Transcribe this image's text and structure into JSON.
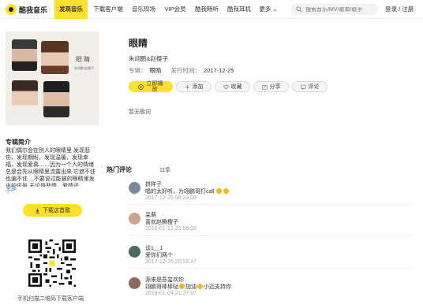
{
  "brand": {
    "name": "酷我音乐",
    "accent": "#ffe12d"
  },
  "nav": {
    "items": [
      {
        "label": "发现音乐",
        "active": true
      },
      {
        "label": "下载客户端"
      },
      {
        "label": "音乐现场"
      },
      {
        "label": "VIP会员"
      },
      {
        "label": "酷我畅听"
      },
      {
        "label": "酷我耳机"
      },
      {
        "label": "更多 ⌄"
      }
    ],
    "search_placeholder": "搜索音乐/MV/歌单/歌手",
    "login": "登录 / 注册"
  },
  "album": {
    "cover_title": "眼睛",
    "cover_subtitle": "朱翊鹏 赵樱子",
    "intro_heading": "专辑简介",
    "intro_text": "我们偶尔会在别人的眼睛里 发现悲伤，发现期盼，发现温暖，发现幸福，发现爱慕……因为一个人的情绪总是会先从眼睛里流露出来 它遮不住 也骗不住 ...不要说过能被的眼睛里发出的讯号 无论是悲情，爱情还...",
    "intro_more": "全部",
    "download_label": "下载这首歌",
    "qr_caption": "手机扫描二维码下载客户端"
  },
  "song": {
    "title": "眼睛",
    "artist": "朱翊鹏&赵樱子",
    "album_label": "专辑：",
    "album_name": "眼睛",
    "release_label": "发行时间：",
    "release_date": "2017-12-25",
    "buttons": {
      "play": "立即播放",
      "add": "添加",
      "fav": "收藏",
      "share": "分享",
      "comment": "评论"
    },
    "no_lyric": "暂无歌词"
  },
  "comments": {
    "heading": "热门评论",
    "count": "11条",
    "items": [
      {
        "user": "拼样子",
        "text": "唱的太好听，为翊鹏哥打call",
        "time": "2017-12-25 08:23:08",
        "avatar_color": "#7a8a9a"
      },
      {
        "user": "呆萌",
        "text": "喜欢赵腾樱子",
        "time": "2018-01-12 22:56:06",
        "avatar_color": "#c9a38b"
      },
      {
        "user": "谈1__1",
        "text": "爱你们两个",
        "time": "2017-12-26 20:55:47",
        "avatar_color": "#4a6b5a"
      },
      {
        "user": "源来是吾玺欢你",
        "text": "翊鹏哥棒棒哒",
        "text2": "加油",
        "text3": "小迈支持你",
        "time": "2018-01-04 21:37:07",
        "avatar_color": "#8a6a5a"
      }
    ]
  }
}
